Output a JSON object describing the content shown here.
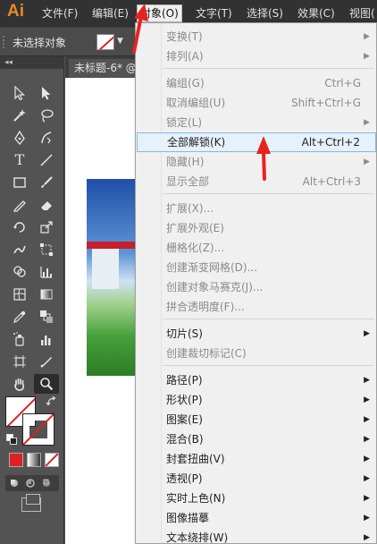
{
  "app": {
    "logo": "Ai"
  },
  "menubar": {
    "items": [
      {
        "label": "文件(F)"
      },
      {
        "label": "编辑(E)"
      },
      {
        "label": "对象(O)"
      },
      {
        "label": "文字(T)"
      },
      {
        "label": "选择(S)"
      },
      {
        "label": "效果(C)"
      },
      {
        "label": "视图("
      }
    ]
  },
  "controlbar": {
    "selection_status": "未选择对象",
    "fill_dropdown": "▼"
  },
  "toolbox": {
    "collapse": "◂◂"
  },
  "document": {
    "tab_title": "未标题-6* @"
  },
  "object_menu": {
    "items": [
      {
        "label": "变换(T)",
        "shortcut": "",
        "submenu": true,
        "disabled": true
      },
      {
        "label": "排列(A)",
        "shortcut": "",
        "submenu": true,
        "disabled": true
      },
      {
        "label": "编组(G)",
        "shortcut": "Ctrl+G",
        "submenu": false,
        "disabled": true
      },
      {
        "label": "取消编组(U)",
        "shortcut": "Shift+Ctrl+G",
        "submenu": false,
        "disabled": true
      },
      {
        "label": "锁定(L)",
        "shortcut": "",
        "submenu": true,
        "disabled": true
      },
      {
        "label": "全部解锁(K)",
        "shortcut": "Alt+Ctrl+2",
        "submenu": false,
        "disabled": false,
        "highlighted": true
      },
      {
        "label": "隐藏(H)",
        "shortcut": "",
        "submenu": true,
        "disabled": true
      },
      {
        "label": "显示全部",
        "shortcut": "Alt+Ctrl+3",
        "submenu": false,
        "disabled": true
      },
      {
        "label": "扩展(X)...",
        "shortcut": "",
        "submenu": false,
        "disabled": true
      },
      {
        "label": "扩展外观(E)",
        "shortcut": "",
        "submenu": false,
        "disabled": true
      },
      {
        "label": "栅格化(Z)...",
        "shortcut": "",
        "submenu": false,
        "disabled": true
      },
      {
        "label": "创建渐变网格(D)...",
        "shortcut": "",
        "submenu": false,
        "disabled": true
      },
      {
        "label": "创建对象马赛克(J)...",
        "shortcut": "",
        "submenu": false,
        "disabled": true
      },
      {
        "label": "拼合透明度(F)...",
        "shortcut": "",
        "submenu": false,
        "disabled": true
      },
      {
        "label": "切片(S)",
        "shortcut": "",
        "submenu": true,
        "disabled": false
      },
      {
        "label": "创建裁切标记(C)",
        "shortcut": "",
        "submenu": false,
        "disabled": true
      },
      {
        "label": "路径(P)",
        "shortcut": "",
        "submenu": true,
        "disabled": false
      },
      {
        "label": "形状(P)",
        "shortcut": "",
        "submenu": true,
        "disabled": false
      },
      {
        "label": "图案(E)",
        "shortcut": "",
        "submenu": true,
        "disabled": false
      },
      {
        "label": "混合(B)",
        "shortcut": "",
        "submenu": true,
        "disabled": false
      },
      {
        "label": "封套扭曲(V)",
        "shortcut": "",
        "submenu": true,
        "disabled": false
      },
      {
        "label": "透视(P)",
        "shortcut": "",
        "submenu": true,
        "disabled": false
      },
      {
        "label": "实时上色(N)",
        "shortcut": "",
        "submenu": true,
        "disabled": false
      },
      {
        "label": "图像描摹",
        "shortcut": "",
        "submenu": true,
        "disabled": false
      },
      {
        "label": "文本绕排(W)",
        "shortcut": "",
        "submenu": true,
        "disabled": false
      }
    ],
    "arrow_glyph": "▶"
  },
  "colors": {
    "menubar_bg": "#323232",
    "panel_bg": "#535353",
    "menu_bg": "#f0f0f0",
    "highlight_bg": "#e5f1fb",
    "annotation_red": "#e8231f",
    "logo_orange": "#e8882c"
  }
}
